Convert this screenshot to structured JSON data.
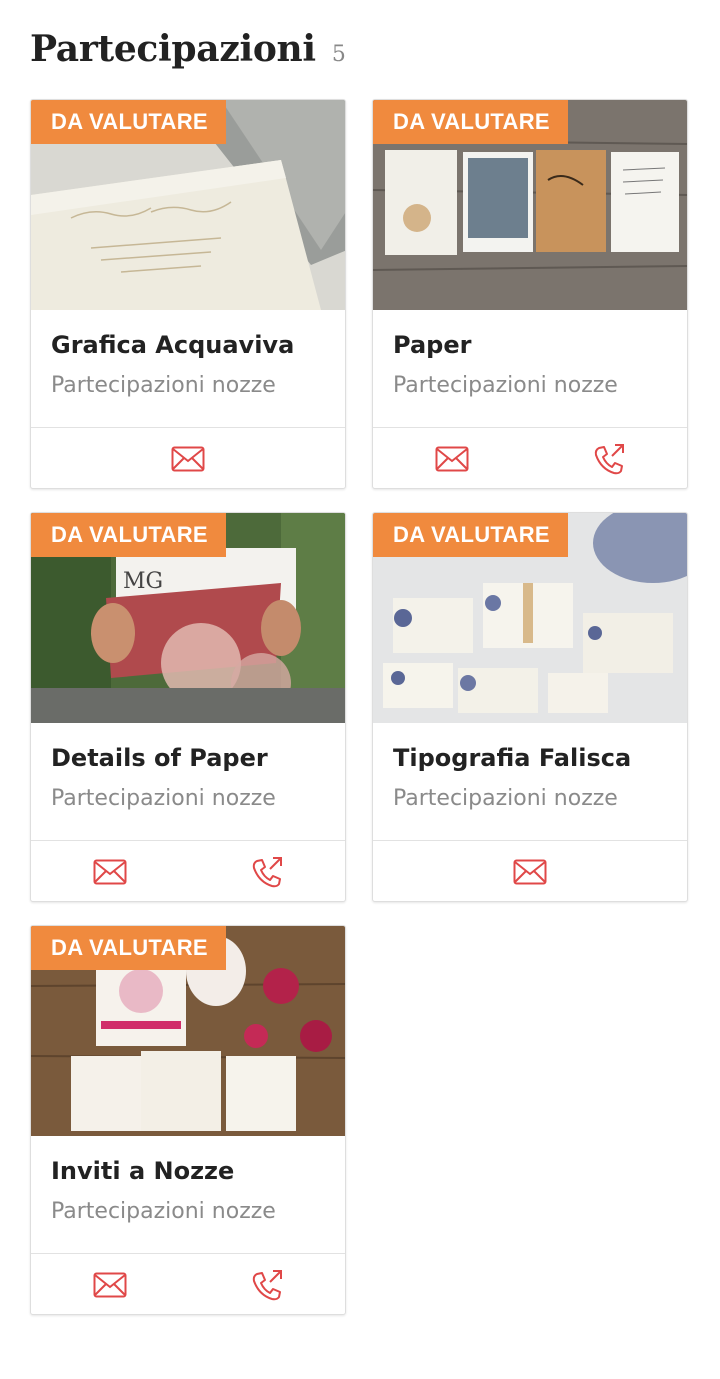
{
  "header": {
    "title": "Partecipazioni",
    "count": "5"
  },
  "accent_color": "#e04848",
  "badge_color": "#f08a3e",
  "cards": [
    {
      "badge": "DA VALUTARE",
      "name": "Grafica Acquaviva",
      "category": "Partecipazioni nozze",
      "actions": [
        "mail-icon"
      ]
    },
    {
      "badge": "DA VALUTARE",
      "name": "Paper",
      "category": "Partecipazioni nozze",
      "actions": [
        "mail-icon",
        "phone-icon"
      ]
    },
    {
      "badge": "DA VALUTARE",
      "name": "Details of Paper",
      "category": "Partecipazioni nozze",
      "actions": [
        "mail-icon",
        "phone-icon"
      ]
    },
    {
      "badge": "DA VALUTARE",
      "name": "Tipografia Falisca",
      "category": "Partecipazioni nozze",
      "actions": [
        "mail-icon"
      ]
    },
    {
      "badge": "DA VALUTARE",
      "name": "Inviti a Nozze",
      "category": "Partecipazioni nozze",
      "actions": [
        "mail-icon",
        "phone-icon"
      ]
    }
  ]
}
